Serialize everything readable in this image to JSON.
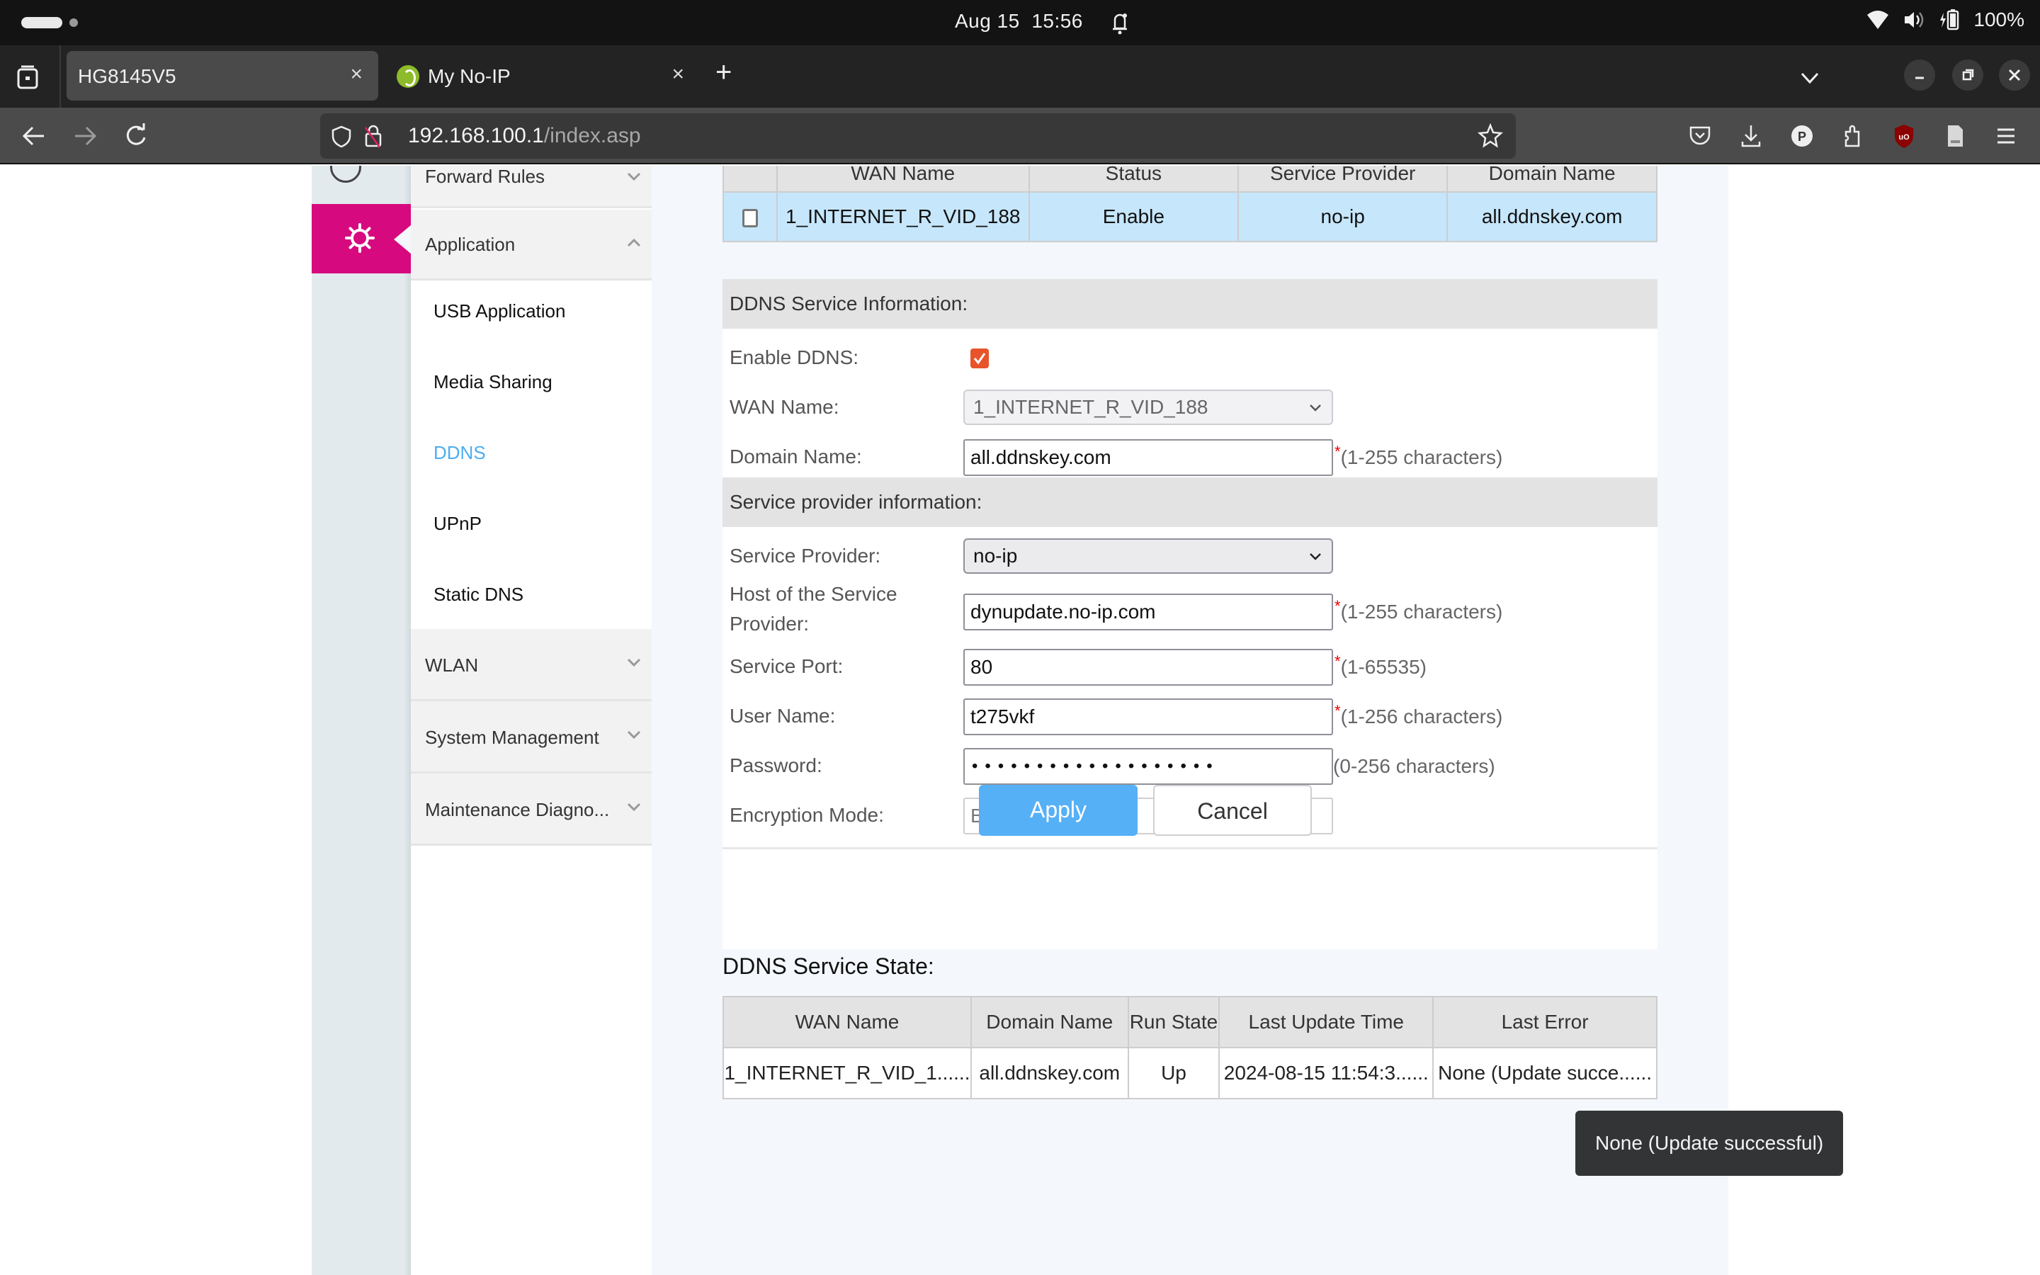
{
  "os": {
    "date": "Aug 15",
    "time": "15:56",
    "battery": "100%"
  },
  "browser": {
    "tabs": [
      {
        "title": "HG8145V5",
        "active": true
      },
      {
        "title": "My No-IP",
        "active": false
      }
    ],
    "url_host": "192.168.100.1",
    "url_path": "/index.asp",
    "close_glyph": "×",
    "newtab_glyph": "+"
  },
  "sidebar": {
    "groups": [
      {
        "label": "Forward Rules",
        "expanded": false
      },
      {
        "label": "Application",
        "expanded": true
      },
      {
        "label": "WLAN",
        "expanded": false
      },
      {
        "label": "System Management",
        "expanded": false
      },
      {
        "label": "Maintenance Diagno...",
        "expanded": false
      }
    ],
    "application_items": [
      {
        "label": "USB Application",
        "active": false
      },
      {
        "label": "Media Sharing",
        "active": false
      },
      {
        "label": "DDNS",
        "active": true
      },
      {
        "label": "UPnP",
        "active": false
      },
      {
        "label": "Static DNS",
        "active": false
      }
    ]
  },
  "wan_table": {
    "headers": [
      "WAN Name",
      "Status",
      "Service Provider",
      "Domain Name"
    ],
    "rows": [
      {
        "checked": false,
        "wan_name": "1_INTERNET_R_VID_188",
        "status": "Enable",
        "provider": "no-ip",
        "domain": "all.ddnskey.com"
      }
    ]
  },
  "ddns_info": {
    "title": "DDNS Service Information:",
    "enable_label": "Enable DDNS:",
    "enable_checked": true,
    "wan_label": "WAN Name:",
    "wan_value": "1_INTERNET_R_VID_188",
    "domain_label": "Domain Name:",
    "domain_value": "all.ddnskey.com",
    "domain_hint": "(1-255 characters)"
  },
  "provider_info": {
    "title": "Service provider information:",
    "provider_label": "Service Provider:",
    "provider_value": "no-ip",
    "host_label": "Host of the Service Provider:",
    "host_value": "dynupdate.no-ip.com",
    "host_hint": "(1-255 characters)",
    "port_label": "Service Port:",
    "port_value": "80",
    "port_hint": "(1-65535)",
    "user_label": "User Name:",
    "user_value": "t275vkf",
    "user_hint": "(1-256 characters)",
    "password_label": "Password:",
    "password_mask": "•••••••••••••••••••",
    "password_hint": "(0-256 characters)",
    "encryption_label": "Encryption Mode:",
    "encryption_value": "BASE64",
    "required_mark": "*"
  },
  "actions": {
    "apply": "Apply",
    "cancel": "Cancel"
  },
  "state": {
    "title": "DDNS Service State:",
    "headers": [
      "WAN Name",
      "Domain Name",
      "Run State",
      "Last Update Time",
      "Last Error"
    ],
    "rows": [
      {
        "wan_name": "1_INTERNET_R_VID_1......",
        "domain": "all.ddnskey.com",
        "run_state": "Up",
        "last_update": "2024-08-15 11:54:3......",
        "last_error": "None (Update succe......"
      }
    ]
  },
  "tooltip": {
    "text": "None (Update successful)"
  },
  "colors": {
    "accent_magenta": "#d60a7e",
    "link_active": "#4daef0",
    "apply_button": "#56b0f6",
    "checkbox_checked": "#e8532a",
    "selected_row": "#c6e6fb"
  }
}
